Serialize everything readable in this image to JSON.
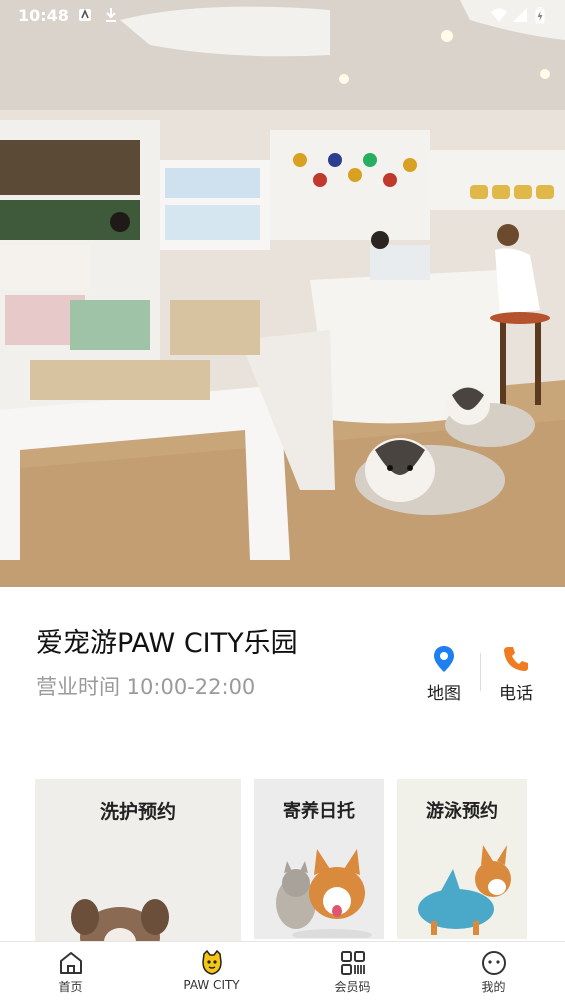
{
  "status_bar": {
    "time": "10:48"
  },
  "store": {
    "name": "爱宠游PAW CITY乐园",
    "hours": "营业时间 10:00-22:00"
  },
  "actions": {
    "map_label": "地图",
    "phone_label": "电话"
  },
  "services": [
    {
      "title": "洗护预约"
    },
    {
      "title": "寄养日托"
    },
    {
      "title": "游泳预约"
    }
  ],
  "nav": [
    {
      "label": "首页",
      "icon": "home-icon"
    },
    {
      "label": "PAW CITY",
      "icon": "paw-city-mascot-icon"
    },
    {
      "label": "会员码",
      "icon": "member-code-icon"
    },
    {
      "label": "我的",
      "icon": "profile-smiley-icon"
    }
  ],
  "colors": {
    "map_pin": "#1e7ff0",
    "phone": "#f07c22",
    "mascot": "#f5c518"
  }
}
